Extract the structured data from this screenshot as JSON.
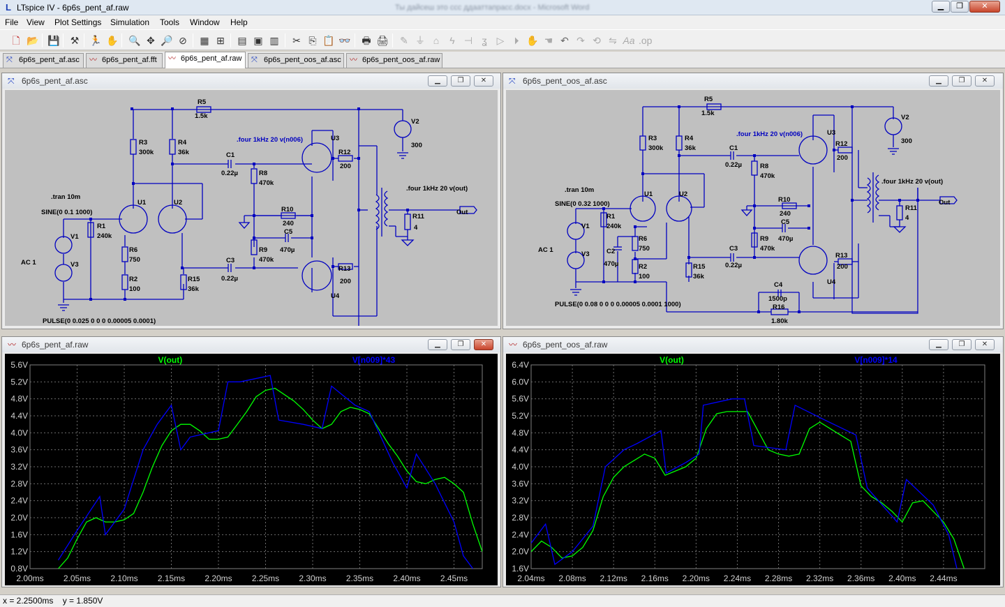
{
  "window": {
    "title": "LTspice IV - 6p6s_pent_af.raw",
    "blurred_text": "Ты дайсеш это ссс ддааттапрасс.docx - Microsoft Word"
  },
  "menu": [
    "File",
    "View",
    "Plot Settings",
    "Simulation",
    "Tools",
    "Window",
    "Help"
  ],
  "tabs": [
    {
      "label": "6p6s_pent_af.asc",
      "icon": "schematic-icon",
      "active": false
    },
    {
      "label": "6p6s_pent_af.fft",
      "icon": "waveform-icon",
      "active": false
    },
    {
      "label": "6p6s_pent_af.raw",
      "icon": "waveform-icon",
      "active": true
    },
    {
      "label": "6p6s_pent_oos_af.asc",
      "icon": "schematic-icon",
      "active": false
    },
    {
      "label": "6p6s_pent_oos_af.raw",
      "icon": "waveform-icon",
      "active": false
    }
  ],
  "panes": {
    "sch1": {
      "title": "6p6s_pent_af.asc",
      "labels": {
        "R5": "R5",
        "R5v": "1.5k",
        "R3": "R3",
        "R3v": "300k",
        "R4": "R4",
        "R4v": "36k",
        "C1": "C1",
        "C1v": "0.22µ",
        "R8": "R8",
        "R8v": "470k",
        "U3": "U3",
        "R12": "R12",
        "R12v": "200",
        "four1": ".four 1kHz 20 v(n006)",
        "V2": "V2",
        "V2v": "300",
        "tran": ".tran 10m",
        "sine": "SINE(0 0.1 1000)",
        "U1": "U1",
        "U2": "U2",
        "R1": "R1",
        "R1v": "240k",
        "V1": "V1",
        "V3": "V3",
        "AC": "AC 1",
        "R6": "R6",
        "R6v": "750",
        "R2": "R2",
        "R2v": "100",
        "R10": "R10",
        "R10v": "240",
        "C5": "C5",
        "C5v": "470µ",
        "R9": "R9",
        "R9v": "470k",
        "C3": "C3",
        "C3v": "0.22µ",
        "R15": "R15",
        "R15v": "36k",
        "R13": "R13",
        "R13v": "200",
        "U4": "U4",
        "R11": "R11",
        "R11v": "4",
        "four2": ".four 1kHz 20 v(out)",
        "Out": "Out",
        "pulse": "PULSE(0 0.025 0 0 0 0.00005 0.0001)"
      }
    },
    "sch2": {
      "title": "6p6s_pent_oos_af.asc",
      "labels": {
        "R5": "R5",
        "R5v": "1.5k",
        "R3": "R3",
        "R3v": "300k",
        "R4": "R4",
        "R4v": "36k",
        "C1": "C1",
        "C1v": "0.22µ",
        "R8": "R8",
        "R8v": "470k",
        "U3": "U3",
        "R12": "R12",
        "R12v": "200",
        "four1": ".four 1kHz 20 v(n006)",
        "V2": "V2",
        "V2v": "300",
        "tran": ".tran 10m",
        "sine": "SINE(0 0.32 1000)",
        "U1": "U1",
        "U2": "U2",
        "R1": "R1",
        "R1v": "240k",
        "V1": "V1",
        "V3": "V3",
        "AC": "AC 1",
        "R6": "R6",
        "R6v": "750",
        "C2": "C2",
        "C2v": "470µ",
        "R2": "R2",
        "R2v": "100",
        "R10": "R10",
        "R10v": "240",
        "C5": "C5",
        "C5v": "470µ",
        "R9": "R9",
        "R9v": "470k",
        "C3": "C3",
        "C3v": "0.22µ",
        "R15": "R15",
        "R15v": "36k",
        "R13": "R13",
        "R13v": "200",
        "U4": "U4",
        "R11": "R11",
        "R11v": "4",
        "four2": ".four 1kHz 20 v(out)",
        "Out": "Out",
        "C4": "C4",
        "C4v": "1500p",
        "R16": "R16",
        "R16v": "1.80k",
        "pulse": "PULSE(0 0.08 0 0 0 0.00005 0.0001 1000)"
      }
    },
    "plot1": {
      "title": "6p6s_pent_af.raw"
    },
    "plot2": {
      "title": "6p6s_pent_oos_af.raw"
    }
  },
  "chart_data": [
    {
      "type": "line",
      "title": "6p6s_pent_af.raw",
      "grid": true,
      "xlim": [
        2.0,
        2.48
      ],
      "ylim": [
        0.8,
        5.6
      ],
      "xticks": [
        "2.00ms",
        "2.05ms",
        "2.10ms",
        "2.15ms",
        "2.20ms",
        "2.25ms",
        "2.30ms",
        "2.35ms",
        "2.40ms",
        "2.45ms"
      ],
      "yticks": [
        "5.6V",
        "5.2V",
        "4.8V",
        "4.4V",
        "4.0V",
        "3.6V",
        "3.2V",
        "2.8V",
        "2.4V",
        "2.0V",
        "1.6V",
        "1.2V",
        "0.8V"
      ],
      "series": [
        {
          "name": "V(out)",
          "color": "#00ff00",
          "x": [
            2.03,
            2.04,
            2.05,
            2.06,
            2.07,
            2.08,
            2.09,
            2.1,
            2.11,
            2.12,
            2.13,
            2.14,
            2.15,
            2.16,
            2.17,
            2.18,
            2.19,
            2.2,
            2.21,
            2.22,
            2.23,
            2.24,
            2.25,
            2.26,
            2.27,
            2.28,
            2.29,
            2.3,
            2.31,
            2.32,
            2.33,
            2.34,
            2.35,
            2.36,
            2.37,
            2.38,
            2.39,
            2.4,
            2.41,
            2.42,
            2.43,
            2.44,
            2.45,
            2.46,
            2.47,
            2.48
          ],
          "y": [
            0.8,
            1.05,
            1.5,
            1.9,
            2.0,
            1.9,
            1.9,
            1.95,
            2.1,
            2.6,
            3.2,
            3.7,
            4.05,
            4.2,
            4.2,
            4.05,
            3.85,
            3.85,
            3.9,
            4.2,
            4.5,
            4.85,
            5.0,
            5.05,
            4.9,
            4.75,
            4.55,
            4.3,
            4.1,
            4.2,
            4.5,
            4.6,
            4.55,
            4.45,
            4.1,
            3.75,
            3.45,
            3.1,
            2.85,
            2.8,
            2.9,
            2.95,
            2.8,
            2.6,
            1.85,
            1.2
          ]
        },
        {
          "name": "V[n009]*43",
          "color": "#0000ff",
          "x": [
            2.03,
            2.05,
            2.074,
            2.08,
            2.1,
            2.12,
            2.135,
            2.15,
            2.16,
            2.17,
            2.2,
            2.21,
            2.223,
            2.255,
            2.264,
            2.29,
            2.31,
            2.32,
            2.345,
            2.36,
            2.385,
            2.4,
            2.41,
            2.43,
            2.45,
            2.46,
            2.47
          ],
          "y": [
            1.0,
            1.7,
            2.5,
            1.6,
            2.2,
            3.6,
            4.2,
            4.65,
            3.6,
            3.9,
            4.05,
            5.2,
            5.2,
            5.35,
            4.3,
            4.2,
            4.1,
            5.1,
            4.65,
            4.5,
            3.3,
            2.7,
            3.5,
            2.8,
            1.9,
            1.1,
            0.8
          ]
        }
      ]
    },
    {
      "type": "line",
      "title": "6p6s_pent_oos_af.raw",
      "grid": true,
      "xlim": [
        2.04,
        2.48
      ],
      "ylim": [
        1.6,
        6.4
      ],
      "xticks": [
        "2.04ms",
        "2.08ms",
        "2.12ms",
        "2.16ms",
        "2.20ms",
        "2.24ms",
        "2.28ms",
        "2.32ms",
        "2.36ms",
        "2.40ms",
        "2.44ms"
      ],
      "yticks": [
        "6.4V",
        "6.0V",
        "5.6V",
        "5.2V",
        "4.8V",
        "4.4V",
        "4.0V",
        "3.6V",
        "3.2V",
        "2.8V",
        "2.4V",
        "2.0V",
        "1.6V"
      ],
      "series": [
        {
          "name": "V(out)",
          "color": "#00ff00",
          "x": [
            2.04,
            2.05,
            2.06,
            2.07,
            2.08,
            2.09,
            2.1,
            2.11,
            2.12,
            2.13,
            2.14,
            2.15,
            2.16,
            2.17,
            2.18,
            2.19,
            2.2,
            2.21,
            2.22,
            2.23,
            2.24,
            2.25,
            2.26,
            2.27,
            2.28,
            2.29,
            2.3,
            2.31,
            2.32,
            2.33,
            2.34,
            2.35,
            2.36,
            2.37,
            2.38,
            2.39,
            2.4,
            2.41,
            2.42,
            2.43,
            2.44,
            2.45,
            2.46
          ],
          "y": [
            2.0,
            2.25,
            2.1,
            1.85,
            1.9,
            2.1,
            2.5,
            3.3,
            3.75,
            4.0,
            4.15,
            4.3,
            4.2,
            3.8,
            3.9,
            4.0,
            4.2,
            4.9,
            5.25,
            5.3,
            5.3,
            5.3,
            4.85,
            4.4,
            4.3,
            4.25,
            4.3,
            4.9,
            5.05,
            4.9,
            4.75,
            4.6,
            3.55,
            3.3,
            3.15,
            2.95,
            2.7,
            3.15,
            3.2,
            2.95,
            2.7,
            2.3,
            1.6
          ]
        },
        {
          "name": "V[n009]*14",
          "color": "#0000ff",
          "x": [
            2.04,
            2.054,
            2.063,
            2.08,
            2.1,
            2.112,
            2.13,
            2.143,
            2.166,
            2.171,
            2.19,
            2.203,
            2.207,
            2.235,
            2.247,
            2.256,
            2.287,
            2.296,
            2.325,
            2.355,
            2.366,
            2.395,
            2.404,
            2.43,
            2.445,
            2.453
          ],
          "y": [
            2.2,
            2.65,
            1.7,
            2.0,
            2.6,
            4.0,
            4.4,
            4.55,
            4.85,
            3.85,
            4.1,
            4.3,
            5.45,
            5.6,
            5.6,
            4.5,
            4.4,
            5.45,
            5.1,
            4.75,
            3.5,
            2.7,
            3.7,
            3.1,
            2.4,
            1.6
          ]
        }
      ]
    }
  ],
  "status": {
    "x": "x = 2.2500ms",
    "y": "y = 1.850V"
  }
}
